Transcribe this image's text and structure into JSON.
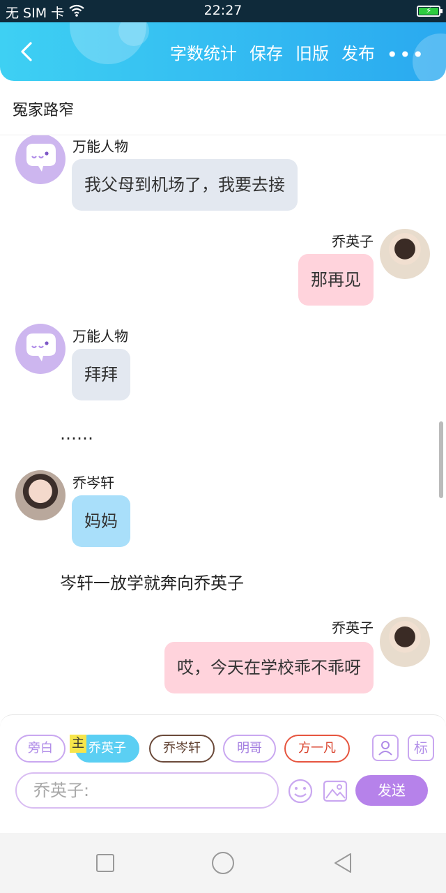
{
  "status_bar": {
    "carrier": "无 SIM 卡",
    "time": "22:27"
  },
  "header": {
    "actions": [
      "字数统计",
      "保存",
      "旧版",
      "发布"
    ],
    "more": "•••"
  },
  "story_title": "冤家路窄",
  "messages": [
    {
      "side": "left",
      "name": "万能人物",
      "text": "我父母到机场了，我要去接",
      "avatar": "npc"
    },
    {
      "side": "right",
      "name": "乔英子",
      "text": "那再见",
      "avatar": "girl"
    },
    {
      "side": "left",
      "name": "万能人物",
      "text": "拜拜",
      "avatar": "npc"
    },
    {
      "type": "narration",
      "text": "……"
    },
    {
      "side": "left",
      "name": "乔岑轩",
      "text": "妈妈",
      "avatar": "boy"
    },
    {
      "type": "narration",
      "text": "岑轩一放学就奔向乔英子"
    },
    {
      "side": "right",
      "name": "乔英子",
      "text": "哎，今天在学校乖不乖呀",
      "avatar": "girl"
    }
  ],
  "composer": {
    "roles": [
      "旁白",
      "乔英子",
      "乔岑轩",
      "明哥",
      "方一凡"
    ],
    "active_role": "乔英子",
    "main_tag": "主",
    "mark_button": "标",
    "input_placeholder": "乔英子:",
    "send_label": "发送"
  },
  "colors": {
    "header_start": "#3ed0f3",
    "header_end": "#2aa9f0",
    "npc_bubble": "#e3e8f0",
    "self_bubble": "#ffd3dc",
    "child_bubble": "#a9dffa",
    "send_button": "#b682ea"
  }
}
